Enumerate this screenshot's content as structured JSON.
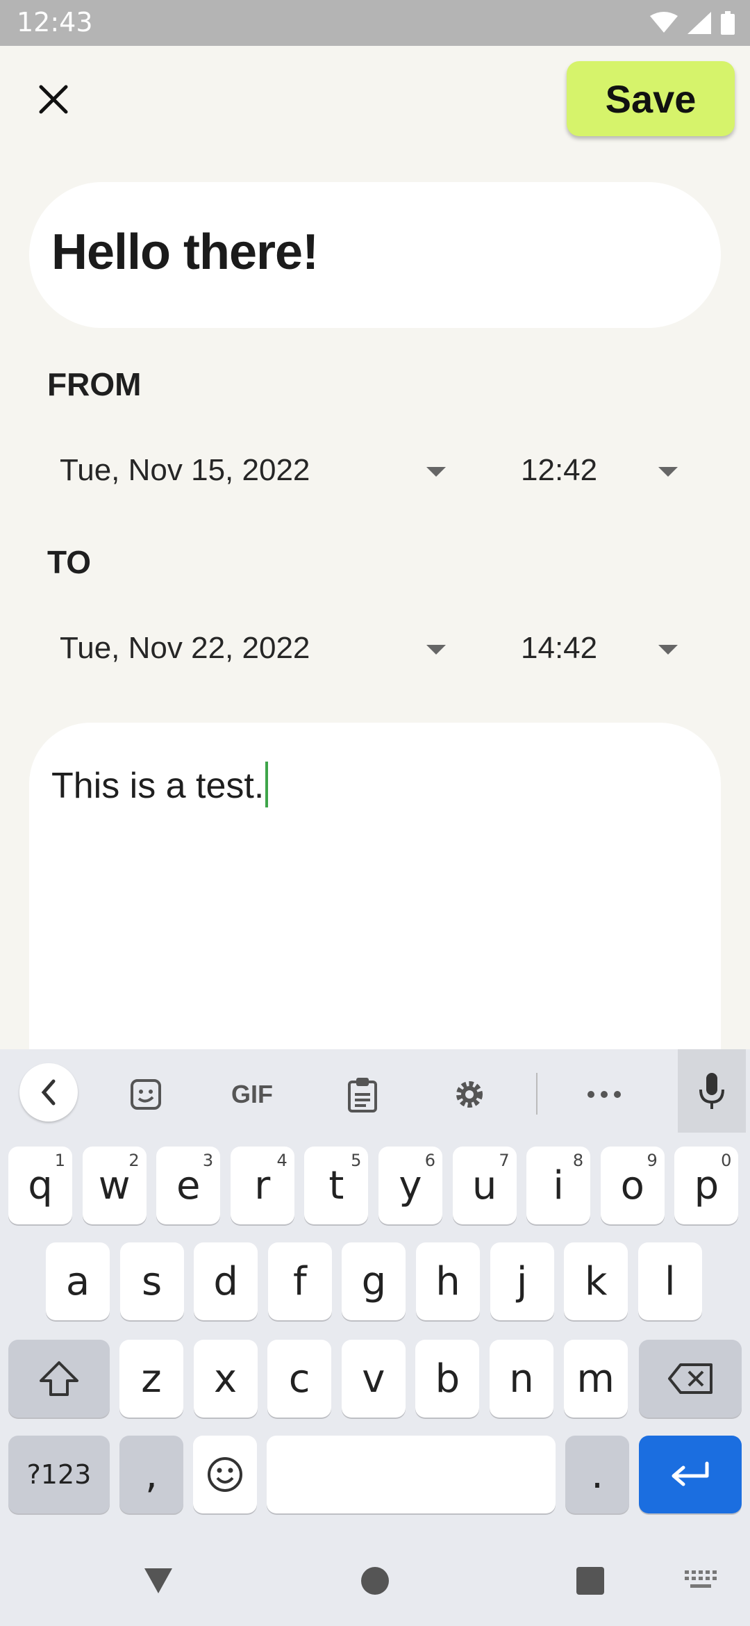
{
  "status_bar": {
    "time": "12:43"
  },
  "toolbar": {
    "save_label": "Save"
  },
  "event": {
    "title": "Hello there!",
    "from_label": "FROM",
    "from_date": "Tue, Nov 15, 2022",
    "from_time": "12:42",
    "to_label": "TO",
    "to_date": "Tue, Nov 22, 2022",
    "to_time": "14:42",
    "note": "This is a test."
  },
  "keyboard": {
    "toolbar": [
      "back",
      "sticker",
      "GIF",
      "clipboard",
      "settings",
      "more",
      "mic"
    ],
    "row1": [
      {
        "k": "q",
        "n": "1"
      },
      {
        "k": "w",
        "n": "2"
      },
      {
        "k": "e",
        "n": "3"
      },
      {
        "k": "r",
        "n": "4"
      },
      {
        "k": "t",
        "n": "5"
      },
      {
        "k": "y",
        "n": "6"
      },
      {
        "k": "u",
        "n": "7"
      },
      {
        "k": "i",
        "n": "8"
      },
      {
        "k": "o",
        "n": "9"
      },
      {
        "k": "p",
        "n": "0"
      }
    ],
    "row2": [
      "a",
      "s",
      "d",
      "f",
      "g",
      "h",
      "j",
      "k",
      "l"
    ],
    "row3": [
      "z",
      "x",
      "c",
      "v",
      "b",
      "n",
      "m"
    ],
    "symbols_label": "?123",
    "comma": ",",
    "period": "."
  }
}
